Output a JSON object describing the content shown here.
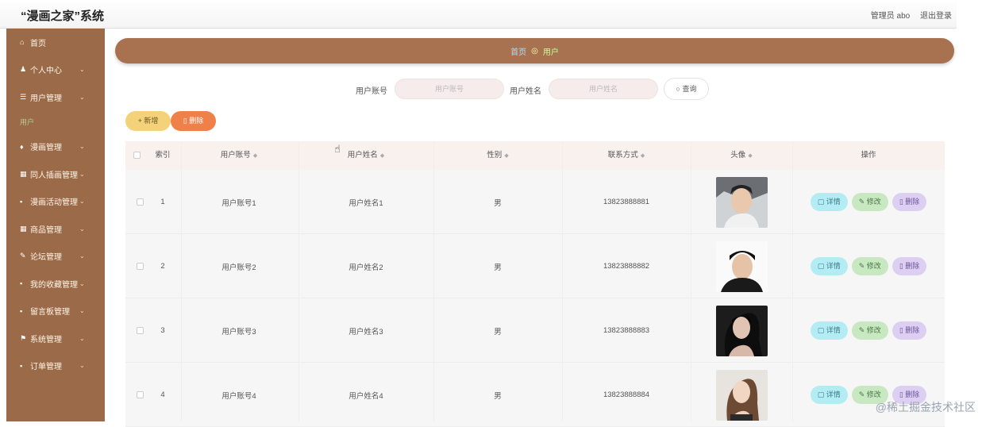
{
  "app": {
    "title": "“漫画之家”系统",
    "admin_text": "管理员 abo",
    "logout": "退出登录"
  },
  "sidebar": {
    "items": [
      {
        "icon": "home-icon",
        "glyph": "⌂",
        "label": "首页",
        "chevron": false
      },
      {
        "icon": "user-icon",
        "glyph": "♟",
        "label": "个人中心",
        "chevron": true
      },
      {
        "icon": "list-icon",
        "glyph": "☰",
        "label": "用户管理",
        "chevron": true
      },
      {
        "icon": "sub",
        "label": "用户"
      },
      {
        "icon": "book-icon",
        "glyph": "♦",
        "label": "漫画管理",
        "chevron": true
      },
      {
        "icon": "image-icon",
        "glyph": "▦",
        "label": "同人插画管理",
        "chevron": true
      },
      {
        "icon": "grid-icon",
        "glyph": "▪",
        "label": "漫画活动管理",
        "chevron": true
      },
      {
        "icon": "grid-icon",
        "glyph": "▦",
        "label": "商品管理",
        "chevron": true
      },
      {
        "icon": "pen-icon",
        "glyph": "✎",
        "label": "论坛管理",
        "chevron": true
      },
      {
        "icon": "grid-icon",
        "glyph": "▪",
        "label": "我的收藏管理",
        "chevron": true
      },
      {
        "icon": "grid-icon",
        "glyph": "▪",
        "label": "留言板管理",
        "chevron": true
      },
      {
        "icon": "flag-icon",
        "glyph": "⚑",
        "label": "系统管理",
        "chevron": true
      },
      {
        "icon": "grid-icon",
        "glyph": "▪",
        "label": "订单管理",
        "chevron": true
      }
    ]
  },
  "breadcrumb": {
    "home": "首页",
    "sep": "◎",
    "current": "用户"
  },
  "search": {
    "account_label": "用户账号",
    "account_placeholder": "用户账号",
    "name_label": "用户姓名",
    "name_placeholder": "用户姓名",
    "query_label": "查询"
  },
  "actions": {
    "add": "+ 新增",
    "delete": "删除"
  },
  "table": {
    "headers": [
      "索引",
      "用户账号",
      "用户姓名",
      "性别",
      "联系方式",
      "头像",
      "操作"
    ],
    "rows": [
      {
        "index": "1",
        "account": "用户账号1",
        "name": "用户姓名1",
        "gender": "男",
        "phone": "13823888881"
      },
      {
        "index": "2",
        "account": "用户账号2",
        "name": "用户姓名2",
        "gender": "男",
        "phone": "13823888882"
      },
      {
        "index": "3",
        "account": "用户账号3",
        "name": "用户姓名3",
        "gender": "男",
        "phone": "13823888883"
      },
      {
        "index": "4",
        "account": "用户账号4",
        "name": "用户姓名4",
        "gender": "男",
        "phone": "13823888884"
      }
    ],
    "ops": {
      "detail": "详情",
      "edit": "修改",
      "delete": "删除"
    }
  },
  "watermark": "@稀土掘金技术社区"
}
